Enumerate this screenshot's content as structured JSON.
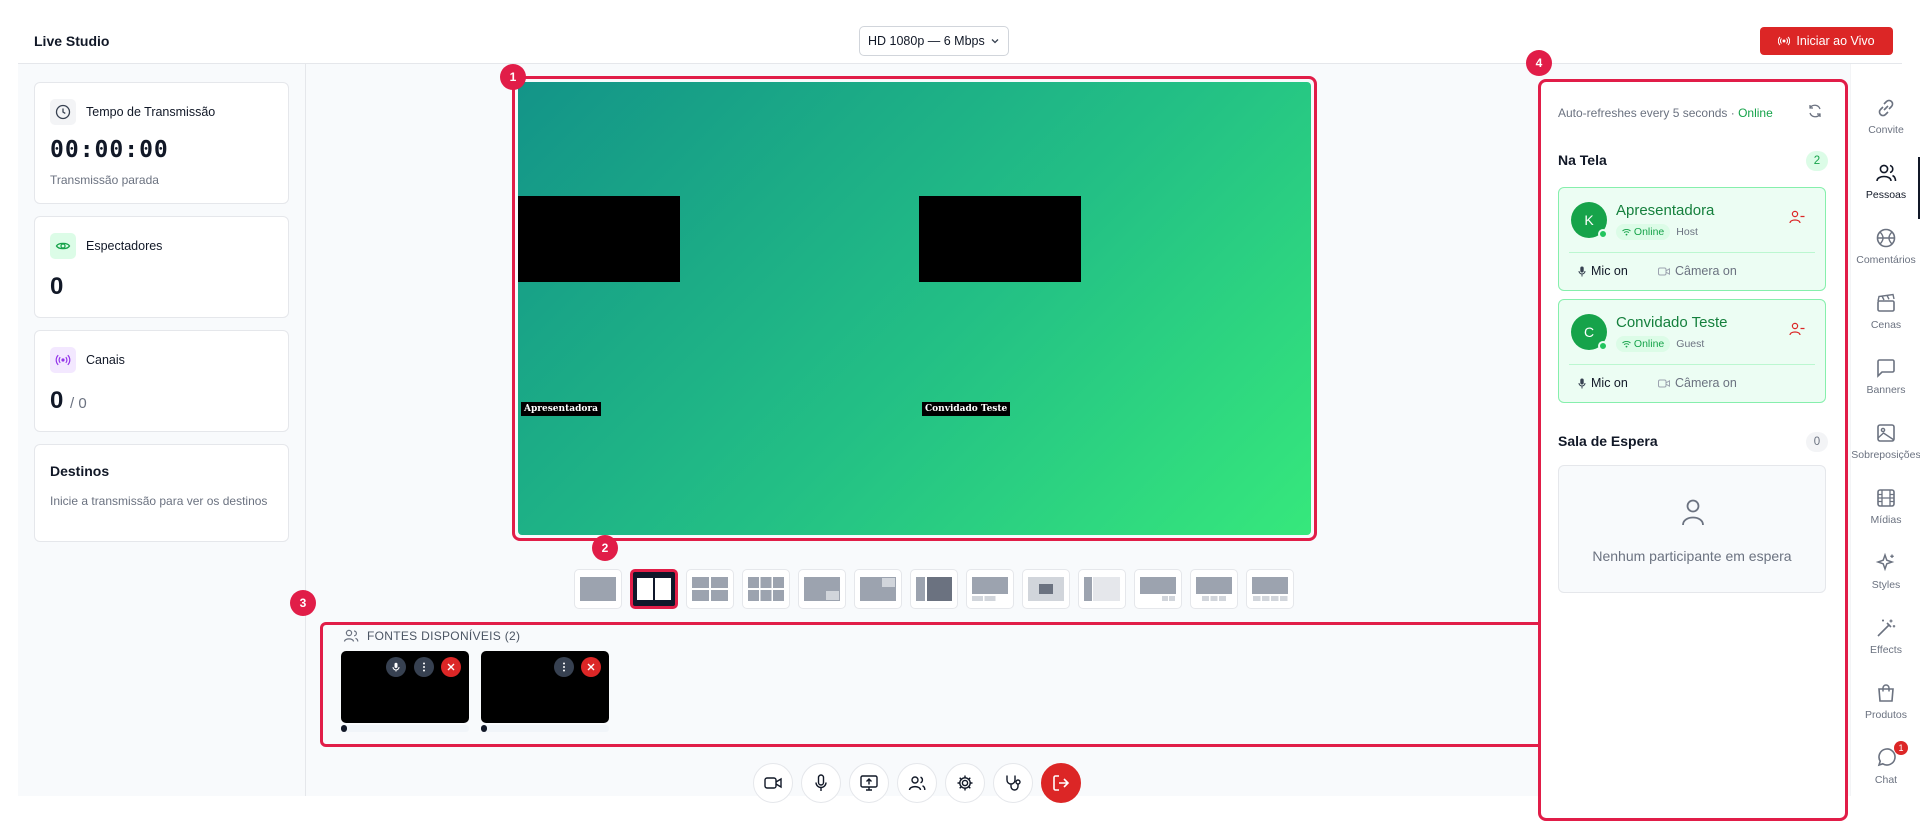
{
  "header": {
    "app_title": "Live Studio",
    "quality": "HD 1080p — 6 Mbps",
    "live_button": "Iniciar ao Vivo"
  },
  "stats": {
    "time": {
      "label": "Tempo de Transmissão",
      "value": "00:00:00",
      "sub": "Transmissão parada"
    },
    "viewers": {
      "label": "Espectadores",
      "value": "0"
    },
    "channels": {
      "label": "Canais",
      "value": "0",
      "of": "/ 0"
    },
    "destinations": {
      "label": "Destinos",
      "text": "Inicie a transmissão para ver os destinos"
    }
  },
  "stage": {
    "labels": [
      "Apresentadora",
      "Convidado Teste"
    ]
  },
  "callouts": [
    "1",
    "2",
    "3",
    "4"
  ],
  "sources": {
    "title": "FONTES DISPONÍVEIS (2)"
  },
  "people_panel": {
    "refresh_text": "Auto-refreshes every 5 seconds · ",
    "refresh_status": "Online",
    "on_screen": {
      "title": "Na Tela",
      "count": "2",
      "participants": [
        {
          "initial": "K",
          "name": "Apresentadora",
          "status": "Online",
          "role": "Host",
          "mic": "Mic on",
          "camera": "Câmera on"
        },
        {
          "initial": "C",
          "name": "Convidado Teste",
          "status": "Online",
          "role": "Guest",
          "mic": "Mic on",
          "camera": "Câmera on"
        }
      ]
    },
    "waiting_room": {
      "title": "Sala de Espera",
      "count": "0",
      "empty_text": "Nenhum participante em espera"
    }
  },
  "rail": {
    "items": [
      {
        "label": "Convite",
        "icon": "link-icon"
      },
      {
        "label": "Pessoas",
        "icon": "people-icon"
      },
      {
        "label": "Comentários",
        "icon": "basketball-icon"
      },
      {
        "label": "Cenas",
        "icon": "clapperboard-icon"
      },
      {
        "label": "Banners",
        "icon": "message-square-icon"
      },
      {
        "label": "Sobreposições",
        "icon": "image-icon"
      },
      {
        "label": "Mídias",
        "icon": "film-icon"
      },
      {
        "label": "Styles",
        "icon": "sparkles-icon"
      },
      {
        "label": "Effects",
        "icon": "magic-wand-icon"
      },
      {
        "label": "Produtos",
        "icon": "shopping-bag-icon"
      },
      {
        "label": "Chat",
        "icon": "chat-icon"
      }
    ],
    "active": "Pessoas",
    "chat_badge": "1"
  },
  "colors": {
    "accent_red": "#dc2626",
    "callout": "#e11d48",
    "online_green": "#16a34a"
  }
}
